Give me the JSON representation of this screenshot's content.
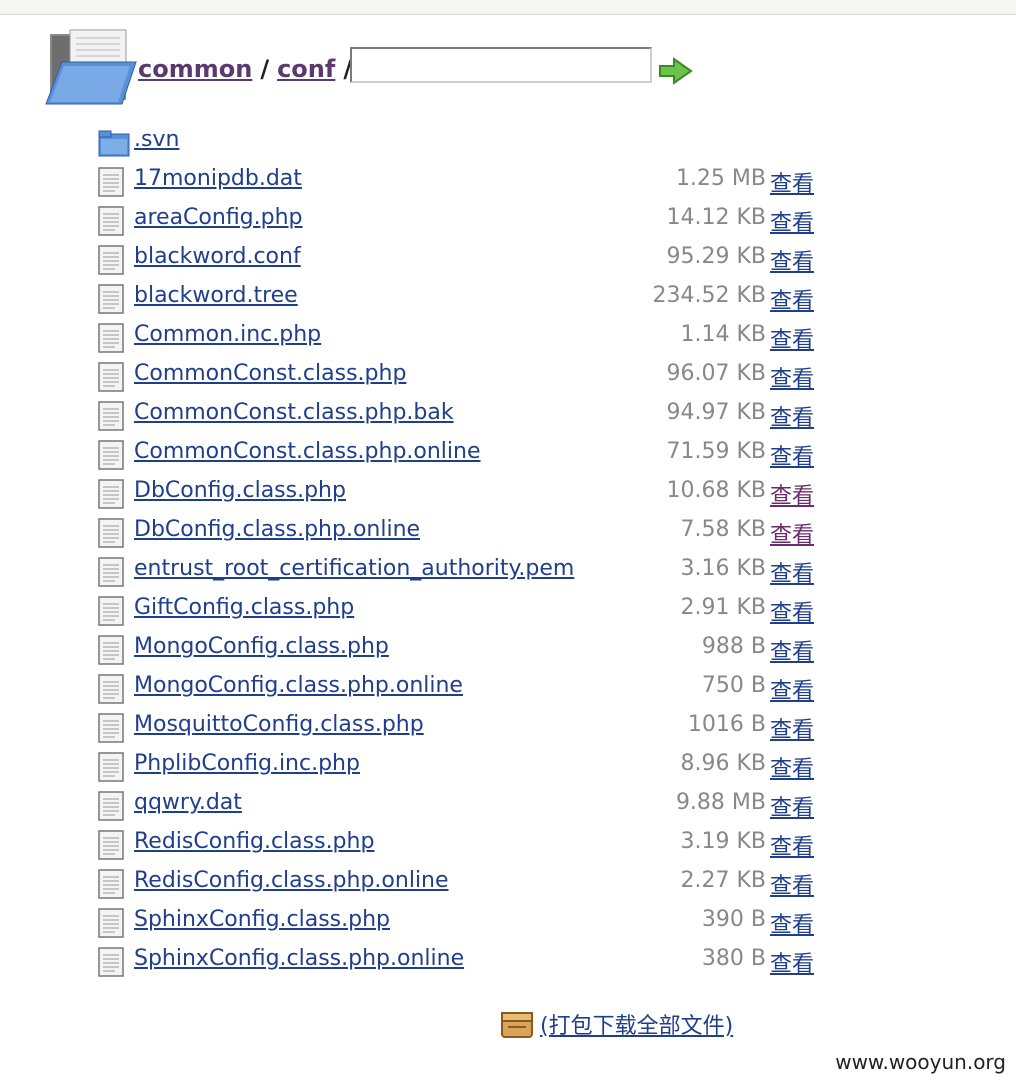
{
  "breadcrumb": {
    "parts": [
      "common",
      "conf"
    ],
    "separator": "/"
  },
  "path_input": {
    "value": ""
  },
  "go_icon": "green-arrow-right-icon",
  "files": [
    {
      "name": ".svn",
      "type": "folder",
      "size": "",
      "view": ""
    },
    {
      "name": "17monipdb.dat",
      "type": "file",
      "size": "1.25 MB",
      "view": "查看"
    },
    {
      "name": "areaConfig.php",
      "type": "file",
      "size": "14.12 KB",
      "view": "查看"
    },
    {
      "name": "blackword.conf",
      "type": "file",
      "size": "95.29 KB",
      "view": "查看"
    },
    {
      "name": "blackword.tree",
      "type": "file",
      "size": "234.52 KB",
      "view": "查看"
    },
    {
      "name": "Common.inc.php",
      "type": "file",
      "size": "1.14 KB",
      "view": "查看"
    },
    {
      "name": "CommonConst.class.php",
      "type": "file",
      "size": "96.07 KB",
      "view": "查看"
    },
    {
      "name": "CommonConst.class.php.bak",
      "type": "file",
      "size": "94.97 KB",
      "view": "查看"
    },
    {
      "name": "CommonConst.class.php.online",
      "type": "file",
      "size": "71.59 KB",
      "view": "查看"
    },
    {
      "name": "DbConfig.class.php",
      "type": "file",
      "size": "10.68 KB",
      "view": "查看",
      "visited": true
    },
    {
      "name": "DbConfig.class.php.online",
      "type": "file",
      "size": "7.58 KB",
      "view": "查看",
      "visited": true
    },
    {
      "name": "entrust_root_certification_authority.pem",
      "type": "file",
      "size": "3.16 KB",
      "view": "查看"
    },
    {
      "name": "GiftConfig.class.php",
      "type": "file",
      "size": "2.91 KB",
      "view": "查看"
    },
    {
      "name": "MongoConfig.class.php",
      "type": "file",
      "size": "988 B",
      "view": "查看"
    },
    {
      "name": "MongoConfig.class.php.online",
      "type": "file",
      "size": "750 B",
      "view": "查看"
    },
    {
      "name": "MosquittoConfig.class.php",
      "type": "file",
      "size": "1016 B",
      "view": "查看"
    },
    {
      "name": "PhplibConfig.inc.php",
      "type": "file",
      "size": "8.96 KB",
      "view": "查看"
    },
    {
      "name": "qqwry.dat",
      "type": "file",
      "size": "9.88 MB",
      "view": "查看"
    },
    {
      "name": "RedisConfig.class.php",
      "type": "file",
      "size": "3.19 KB",
      "view": "查看"
    },
    {
      "name": "RedisConfig.class.php.online",
      "type": "file",
      "size": "2.27 KB",
      "view": "查看"
    },
    {
      "name": "SphinxConfig.class.php",
      "type": "file",
      "size": "390 B",
      "view": "查看"
    },
    {
      "name": "SphinxConfig.class.php.online",
      "type": "file",
      "size": "380 B",
      "view": "查看"
    }
  ],
  "download_all": {
    "label": "(打包下载全部文件)",
    "icon": "archive-box-icon"
  },
  "watermark": "www.wooyun.org",
  "colors": {
    "link": "#1f3e8c",
    "visited": "#6a2c6e",
    "size": "#888888"
  }
}
